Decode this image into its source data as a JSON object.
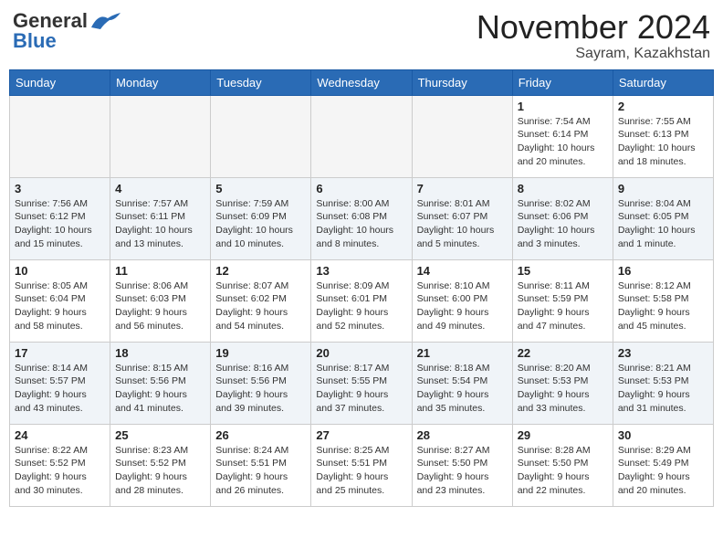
{
  "header": {
    "logo_line1": "General",
    "logo_line2": "Blue",
    "month_title": "November 2024",
    "location": "Sayram, Kazakhstan"
  },
  "days_of_week": [
    "Sunday",
    "Monday",
    "Tuesday",
    "Wednesday",
    "Thursday",
    "Friday",
    "Saturday"
  ],
  "weeks": [
    [
      {
        "day": "",
        "info": ""
      },
      {
        "day": "",
        "info": ""
      },
      {
        "day": "",
        "info": ""
      },
      {
        "day": "",
        "info": ""
      },
      {
        "day": "",
        "info": ""
      },
      {
        "day": "1",
        "info": "Sunrise: 7:54 AM\nSunset: 6:14 PM\nDaylight: 10 hours\nand 20 minutes."
      },
      {
        "day": "2",
        "info": "Sunrise: 7:55 AM\nSunset: 6:13 PM\nDaylight: 10 hours\nand 18 minutes."
      }
    ],
    [
      {
        "day": "3",
        "info": "Sunrise: 7:56 AM\nSunset: 6:12 PM\nDaylight: 10 hours\nand 15 minutes."
      },
      {
        "day": "4",
        "info": "Sunrise: 7:57 AM\nSunset: 6:11 PM\nDaylight: 10 hours\nand 13 minutes."
      },
      {
        "day": "5",
        "info": "Sunrise: 7:59 AM\nSunset: 6:09 PM\nDaylight: 10 hours\nand 10 minutes."
      },
      {
        "day": "6",
        "info": "Sunrise: 8:00 AM\nSunset: 6:08 PM\nDaylight: 10 hours\nand 8 minutes."
      },
      {
        "day": "7",
        "info": "Sunrise: 8:01 AM\nSunset: 6:07 PM\nDaylight: 10 hours\nand 5 minutes."
      },
      {
        "day": "8",
        "info": "Sunrise: 8:02 AM\nSunset: 6:06 PM\nDaylight: 10 hours\nand 3 minutes."
      },
      {
        "day": "9",
        "info": "Sunrise: 8:04 AM\nSunset: 6:05 PM\nDaylight: 10 hours\nand 1 minute."
      }
    ],
    [
      {
        "day": "10",
        "info": "Sunrise: 8:05 AM\nSunset: 6:04 PM\nDaylight: 9 hours\nand 58 minutes."
      },
      {
        "day": "11",
        "info": "Sunrise: 8:06 AM\nSunset: 6:03 PM\nDaylight: 9 hours\nand 56 minutes."
      },
      {
        "day": "12",
        "info": "Sunrise: 8:07 AM\nSunset: 6:02 PM\nDaylight: 9 hours\nand 54 minutes."
      },
      {
        "day": "13",
        "info": "Sunrise: 8:09 AM\nSunset: 6:01 PM\nDaylight: 9 hours\nand 52 minutes."
      },
      {
        "day": "14",
        "info": "Sunrise: 8:10 AM\nSunset: 6:00 PM\nDaylight: 9 hours\nand 49 minutes."
      },
      {
        "day": "15",
        "info": "Sunrise: 8:11 AM\nSunset: 5:59 PM\nDaylight: 9 hours\nand 47 minutes."
      },
      {
        "day": "16",
        "info": "Sunrise: 8:12 AM\nSunset: 5:58 PM\nDaylight: 9 hours\nand 45 minutes."
      }
    ],
    [
      {
        "day": "17",
        "info": "Sunrise: 8:14 AM\nSunset: 5:57 PM\nDaylight: 9 hours\nand 43 minutes."
      },
      {
        "day": "18",
        "info": "Sunrise: 8:15 AM\nSunset: 5:56 PM\nDaylight: 9 hours\nand 41 minutes."
      },
      {
        "day": "19",
        "info": "Sunrise: 8:16 AM\nSunset: 5:56 PM\nDaylight: 9 hours\nand 39 minutes."
      },
      {
        "day": "20",
        "info": "Sunrise: 8:17 AM\nSunset: 5:55 PM\nDaylight: 9 hours\nand 37 minutes."
      },
      {
        "day": "21",
        "info": "Sunrise: 8:18 AM\nSunset: 5:54 PM\nDaylight: 9 hours\nand 35 minutes."
      },
      {
        "day": "22",
        "info": "Sunrise: 8:20 AM\nSunset: 5:53 PM\nDaylight: 9 hours\nand 33 minutes."
      },
      {
        "day": "23",
        "info": "Sunrise: 8:21 AM\nSunset: 5:53 PM\nDaylight: 9 hours\nand 31 minutes."
      }
    ],
    [
      {
        "day": "24",
        "info": "Sunrise: 8:22 AM\nSunset: 5:52 PM\nDaylight: 9 hours\nand 30 minutes."
      },
      {
        "day": "25",
        "info": "Sunrise: 8:23 AM\nSunset: 5:52 PM\nDaylight: 9 hours\nand 28 minutes."
      },
      {
        "day": "26",
        "info": "Sunrise: 8:24 AM\nSunset: 5:51 PM\nDaylight: 9 hours\nand 26 minutes."
      },
      {
        "day": "27",
        "info": "Sunrise: 8:25 AM\nSunset: 5:51 PM\nDaylight: 9 hours\nand 25 minutes."
      },
      {
        "day": "28",
        "info": "Sunrise: 8:27 AM\nSunset: 5:50 PM\nDaylight: 9 hours\nand 23 minutes."
      },
      {
        "day": "29",
        "info": "Sunrise: 8:28 AM\nSunset: 5:50 PM\nDaylight: 9 hours\nand 22 minutes."
      },
      {
        "day": "30",
        "info": "Sunrise: 8:29 AM\nSunset: 5:49 PM\nDaylight: 9 hours\nand 20 minutes."
      }
    ]
  ]
}
